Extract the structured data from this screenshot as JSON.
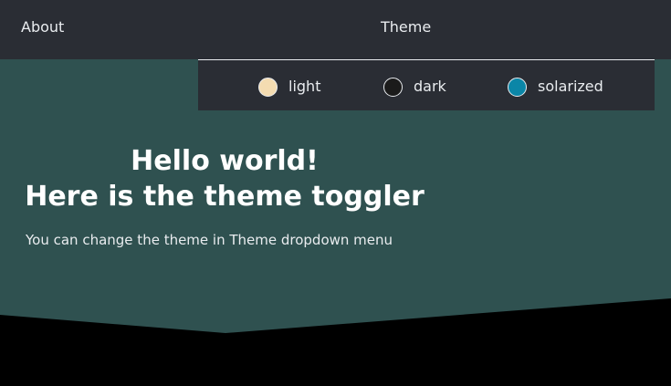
{
  "nav": {
    "about_label": "About",
    "theme_label": "Theme"
  },
  "theme_menu": {
    "options": [
      {
        "label": "light",
        "swatch_color": "#f4dcb1"
      },
      {
        "label": "dark",
        "swatch_color": "#1b1b1b"
      },
      {
        "label": "solarized",
        "swatch_color": "#0b86a7"
      }
    ]
  },
  "hero": {
    "title_line1": "Hello world!",
    "title_line2": "Here is the theme toggler",
    "subtitle": "You can change the theme in Theme dropdown menu"
  },
  "colors": {
    "navbar_bg": "#2a2d34",
    "hero_bg": "#2f5150",
    "page_bottom": "#000000",
    "text": "#ffffff"
  }
}
